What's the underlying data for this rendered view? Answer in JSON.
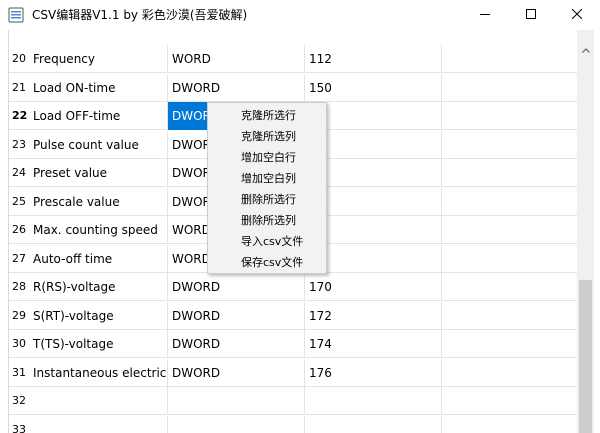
{
  "window": {
    "title": "CSV编辑器V1.1   by 彩色沙漠(吾爱破解)",
    "minimize_label": "minimize",
    "maximize_label": "maximize",
    "close_label": "close"
  },
  "table": {
    "rows": [
      {
        "num": "20",
        "cells": [
          "Frequency",
          "WORD",
          "112",
          ""
        ]
      },
      {
        "num": "21",
        "cells": [
          "Load ON-time",
          "DWORD",
          "150",
          ""
        ]
      },
      {
        "num": "22",
        "cells": [
          "Load OFF-time",
          "DWORD",
          "",
          ""
        ]
      },
      {
        "num": "23",
        "cells": [
          "Pulse count value",
          "DWORD",
          "",
          ""
        ]
      },
      {
        "num": "24",
        "cells": [
          "Preset value",
          "DWORD",
          "",
          ""
        ]
      },
      {
        "num": "25",
        "cells": [
          "Prescale value",
          "DWORD",
          "",
          ""
        ]
      },
      {
        "num": "26",
        "cells": [
          "Max. counting speed",
          "WORD",
          "",
          ""
        ]
      },
      {
        "num": "27",
        "cells": [
          "Auto-off time",
          "WORD",
          "",
          ""
        ]
      },
      {
        "num": "28",
        "cells": [
          "R(RS)-voltage",
          "DWORD",
          "170",
          ""
        ]
      },
      {
        "num": "29",
        "cells": [
          "S(RT)-voltage",
          "DWORD",
          "172",
          ""
        ]
      },
      {
        "num": "30",
        "cells": [
          "T(TS)-voltage",
          "DWORD",
          "174",
          ""
        ]
      },
      {
        "num": "31",
        "cells": [
          "Instantaneous electric...",
          "DWORD",
          "176",
          ""
        ]
      },
      {
        "num": "32",
        "cells": [
          "",
          "",
          "",
          ""
        ]
      },
      {
        "num": "33",
        "cells": [
          "",
          "",
          "",
          ""
        ]
      }
    ],
    "current_row": "22",
    "selected_cell_text": "DWORD"
  },
  "context_menu": {
    "items": [
      "克隆所选行",
      "克隆所选列",
      "增加空白行",
      "增加空白列",
      "删除所选行",
      "删除所选列",
      "导入csv文件",
      "保存csv文件"
    ]
  },
  "colors": {
    "selection": "#0078d7",
    "menu_bg": "#f2f2f2",
    "grid_line": "#e3e3e3",
    "scroll_thumb": "#cdcdcd"
  }
}
